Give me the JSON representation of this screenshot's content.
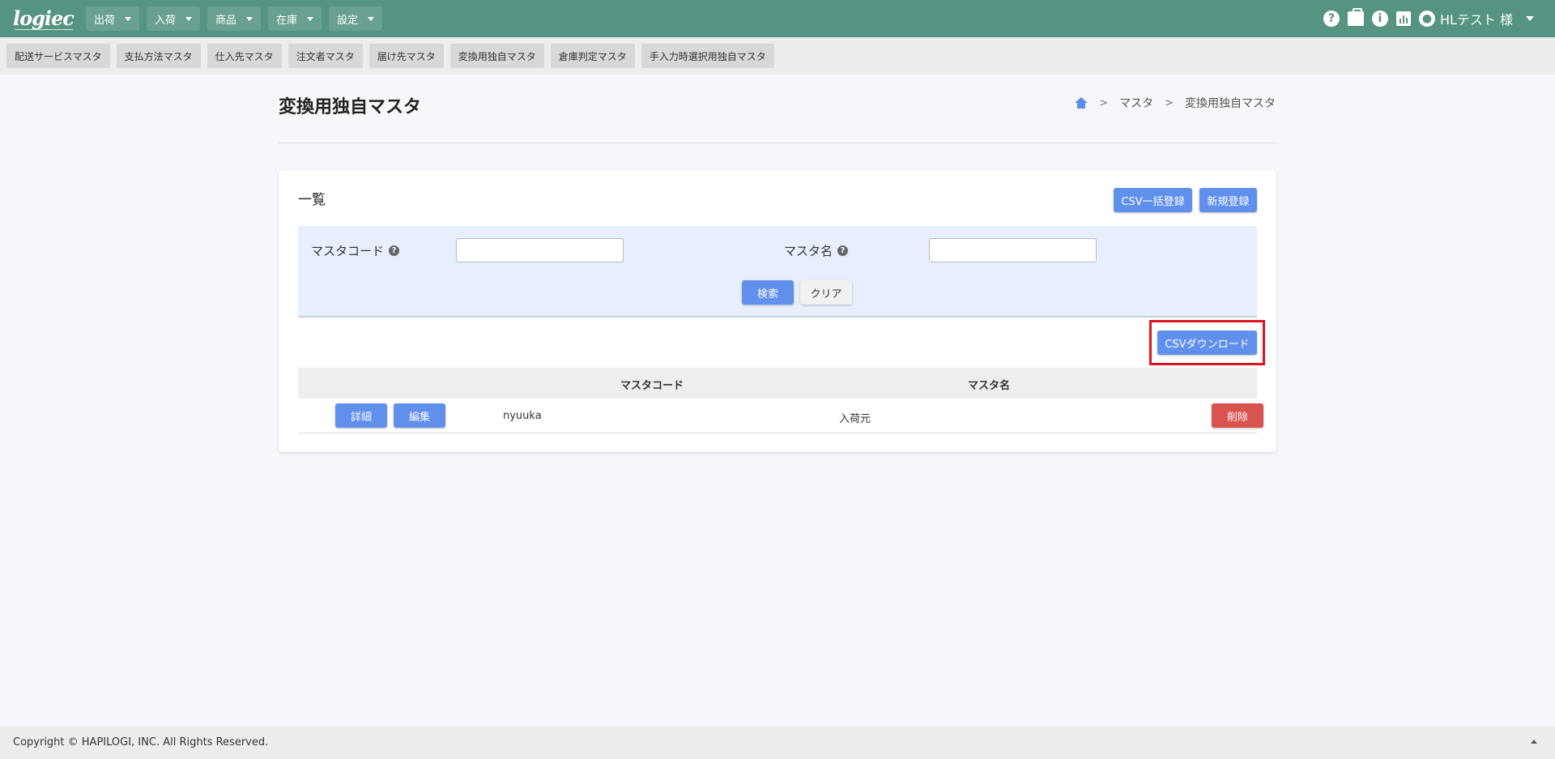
{
  "app": {
    "logo": "logiec"
  },
  "nav": {
    "menus": [
      {
        "label": "出荷"
      },
      {
        "label": "入荷"
      },
      {
        "label": "商品"
      },
      {
        "label": "在庫"
      },
      {
        "label": "設定"
      }
    ],
    "user_label": "HLテスト 様"
  },
  "subnav": {
    "tabs": [
      {
        "label": "配送サービスマスタ"
      },
      {
        "label": "支払方法マスタ"
      },
      {
        "label": "仕入先マスタ"
      },
      {
        "label": "注文者マスタ"
      },
      {
        "label": "届け先マスタ"
      },
      {
        "label": "変換用独自マスタ"
      },
      {
        "label": "倉庫判定マスタ"
      },
      {
        "label": "手入力時選択用独自マスタ"
      }
    ]
  },
  "page": {
    "title": "変換用独自マスタ",
    "breadcrumb": {
      "level1": "マスタ",
      "level2": "変換用独自マスタ"
    }
  },
  "list": {
    "title": "一覧",
    "csv_bulk_label": "CSV一括登録",
    "new_label": "新規登録",
    "search": {
      "code_label": "マスタコード",
      "code_value": "",
      "name_label": "マスタ名",
      "name_value": "",
      "search_label": "検索",
      "clear_label": "クリア"
    },
    "csv_download_label": "CSVダウンロード",
    "table": {
      "headers": {
        "code": "マスタコード",
        "name": "マスタ名"
      },
      "rows": [
        {
          "detail_label": "詳細",
          "edit_label": "編集",
          "code": "nyuuka",
          "name": "入荷元",
          "delete_label": "削除"
        }
      ]
    }
  },
  "footer": {
    "copyright": "Copyright © HAPILOGI, INC. All Rights Reserved."
  },
  "colors": {
    "navbar": "#559383",
    "primary": "#6190ec",
    "danger": "#d9534f",
    "highlight": "#e0141e"
  }
}
